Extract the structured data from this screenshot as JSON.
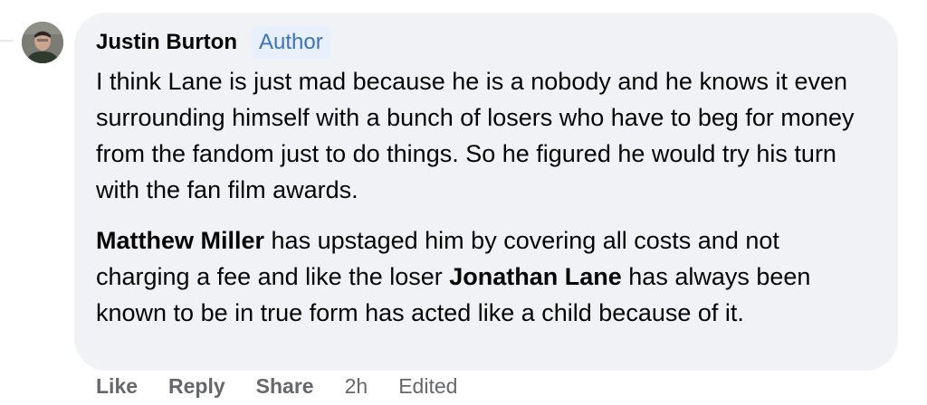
{
  "comment": {
    "author": "Justin Burton",
    "badge": "Author",
    "paragraph1": "I think Lane is just mad because he is a nobody and he knows it even surrounding himself with a bunch of losers who have to beg for money from the fandom just to do things. So he figured he would try his turn with the fan film awards.",
    "paragraph2": {
      "mention1": "Matthew Miller",
      "text1": " has upstaged him by covering all costs and not charging a fee and like the loser ",
      "mention2": "Jonathan Lane",
      "text2": " has always been known to be in true form has acted like a child because of it."
    }
  },
  "actions": {
    "like": "Like",
    "reply": "Reply",
    "share": "Share",
    "time": "2h",
    "edited": "Edited"
  }
}
